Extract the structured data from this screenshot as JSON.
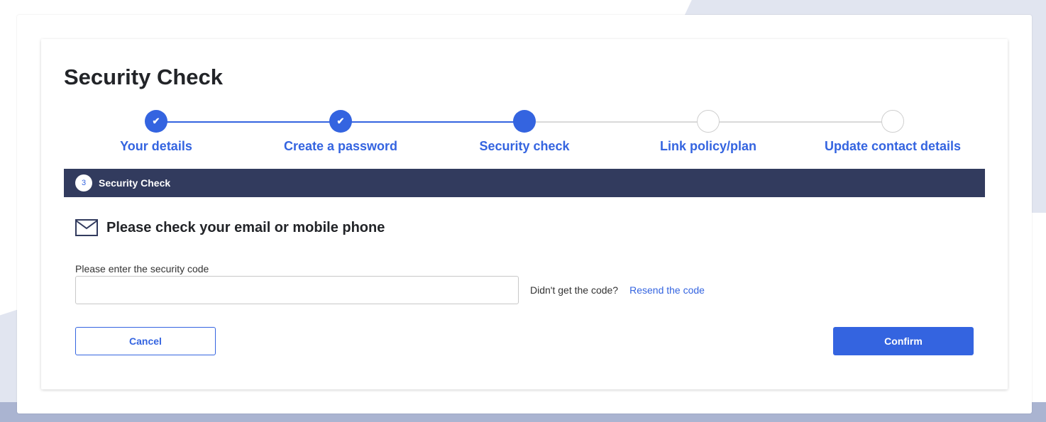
{
  "page": {
    "title": "Security Check"
  },
  "stepper": {
    "steps": [
      {
        "label": "Your details",
        "state": "complete"
      },
      {
        "label": "Create a password",
        "state": "complete"
      },
      {
        "label": "Security check",
        "state": "current"
      },
      {
        "label": "Link policy/plan",
        "state": "upcoming"
      },
      {
        "label": "Update contact details",
        "state": "upcoming"
      }
    ],
    "check_glyph": "✔"
  },
  "section": {
    "number": "3",
    "title": "Security Check"
  },
  "check": {
    "heading": "Please check your email or mobile phone",
    "icon": "envelope-icon"
  },
  "code_field": {
    "label": "Please enter the security code",
    "value": "",
    "placeholder": ""
  },
  "resend": {
    "prompt": "Didn't get the code?",
    "link_label": "Resend the code"
  },
  "buttons": {
    "cancel_label": "Cancel",
    "confirm_label": "Confirm"
  },
  "colors": {
    "accent": "#3464e0",
    "section_bar": "#323b5e",
    "text": "#222428"
  }
}
